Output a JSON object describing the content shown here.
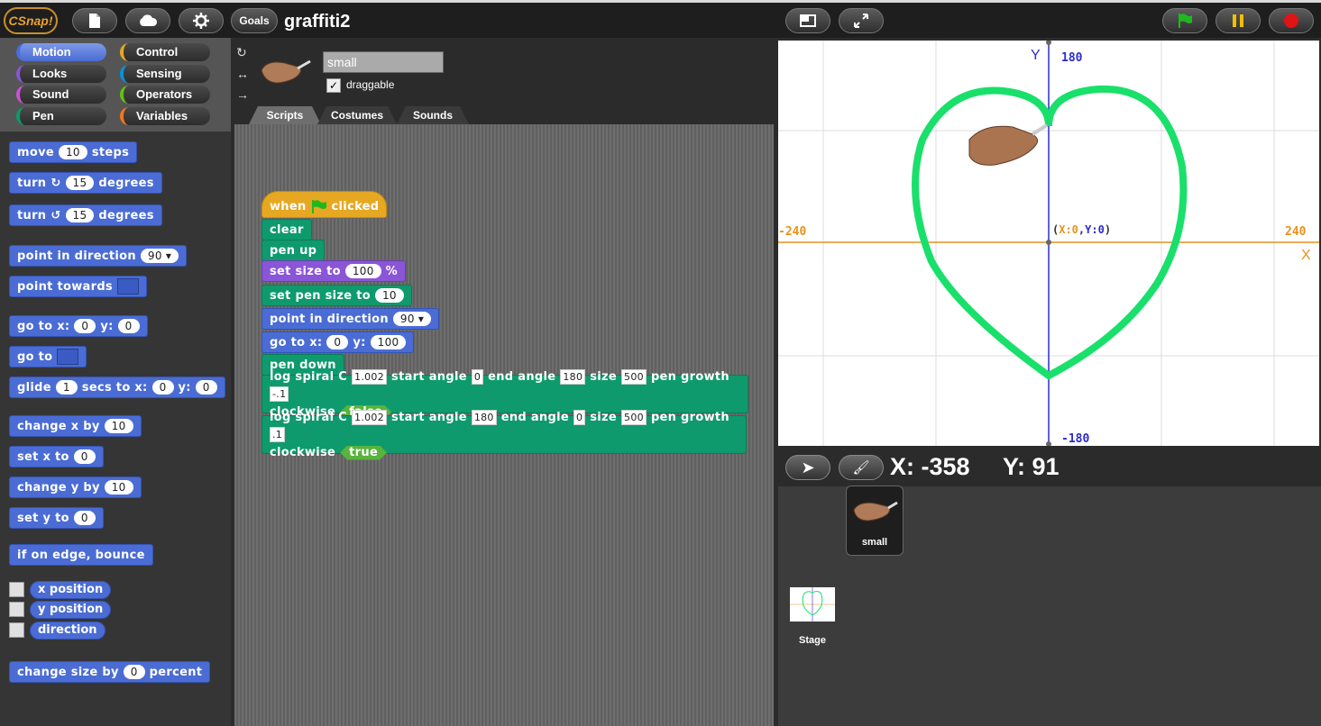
{
  "app": {
    "logo_text": "CSnap!",
    "goals_label": "Goals",
    "project_title": "graffiti2"
  },
  "categories": [
    "Motion",
    "Looks",
    "Sound",
    "Pen",
    "Control",
    "Sensing",
    "Operators",
    "Variables"
  ],
  "palette": {
    "move": {
      "a": "move",
      "v": "10",
      "b": "steps"
    },
    "turn_cw": {
      "a": "turn",
      "v": "15",
      "b": "degrees"
    },
    "turn_ccw": {
      "a": "turn",
      "v": "15",
      "b": "degrees"
    },
    "point_dir": {
      "a": "point in direction",
      "v": "90"
    },
    "point_towards": {
      "a": "point towards"
    },
    "goto_xy": {
      "a": "go to x:",
      "x": "0",
      "m": "y:",
      "y": "0"
    },
    "goto": {
      "a": "go to"
    },
    "glide": {
      "a": "glide",
      "s": "1",
      "m": "secs to x:",
      "x": "0",
      "m2": "y:",
      "y": "0"
    },
    "change_x": {
      "a": "change x by",
      "v": "10"
    },
    "set_x": {
      "a": "set x to",
      "v": "0"
    },
    "change_y": {
      "a": "change y by",
      "v": "10"
    },
    "set_y": {
      "a": "set y to",
      "v": "0"
    },
    "bounce": {
      "a": "if on edge, bounce"
    },
    "rep_x": "x position",
    "rep_y": "y position",
    "rep_dir": "direction",
    "change_size": {
      "a": "change size by",
      "v": "0",
      "b": "percent"
    }
  },
  "sprite": {
    "name": "small",
    "draggable_label": "draggable",
    "draggable": true
  },
  "tabs": [
    "Scripts",
    "Costumes",
    "Sounds"
  ],
  "script": {
    "hat": {
      "a": "when",
      "b": "clicked"
    },
    "clear": "clear",
    "pen_up": "pen up",
    "set_size": {
      "a": "set size to",
      "v": "100",
      "b": "%"
    },
    "set_pen_size": {
      "a": "set pen size to",
      "v": "10"
    },
    "point_dir": {
      "a": "point in direction",
      "v": "90"
    },
    "goto": {
      "a": "go to x:",
      "x": "0",
      "m": "y:",
      "y": "100"
    },
    "pen_down": "pen down",
    "spiral1": {
      "a": "log spiral C",
      "c": "1.002",
      "m1": "start angle",
      "s": "0",
      "m2": "end angle",
      "e": "180",
      "m3": "size",
      "z": "500",
      "m4": "pen growth",
      "g": "-.1",
      "cw": "clockwise",
      "b": "false"
    },
    "spiral2": {
      "a": "log spiral C",
      "c": "1.002",
      "m1": "start angle",
      "s": "180",
      "m2": "end angle",
      "e": "0",
      "m3": "size",
      "z": "500",
      "m4": "pen growth",
      "g": ".1",
      "cw": "clockwise",
      "b": "true"
    }
  },
  "stage": {
    "y_label": "Y",
    "x_label": "X",
    "y_max": "180",
    "y_min": "-180",
    "x_min": "-240",
    "x_max": "240",
    "origin_label_x": "X:0",
    "origin_label_y": "Y:0",
    "axis_color": "#e8921c",
    "y_axis_color": "#2b2bcf",
    "heart_color": "#19e06a"
  },
  "mouse": {
    "x": "X: -358",
    "y": "Y: 91"
  },
  "corral": {
    "sprite_label": "small",
    "stage_label": "Stage"
  },
  "icons": {
    "new": "file-icon",
    "cloud": "cloud-icon",
    "settings": "gear-icon",
    "stage_size": "normal-stage-icon",
    "fullscreen": "fullscreen-icon",
    "green_flag": "green-flag-icon",
    "pause": "pause-icon",
    "stop": "stop-icon"
  }
}
